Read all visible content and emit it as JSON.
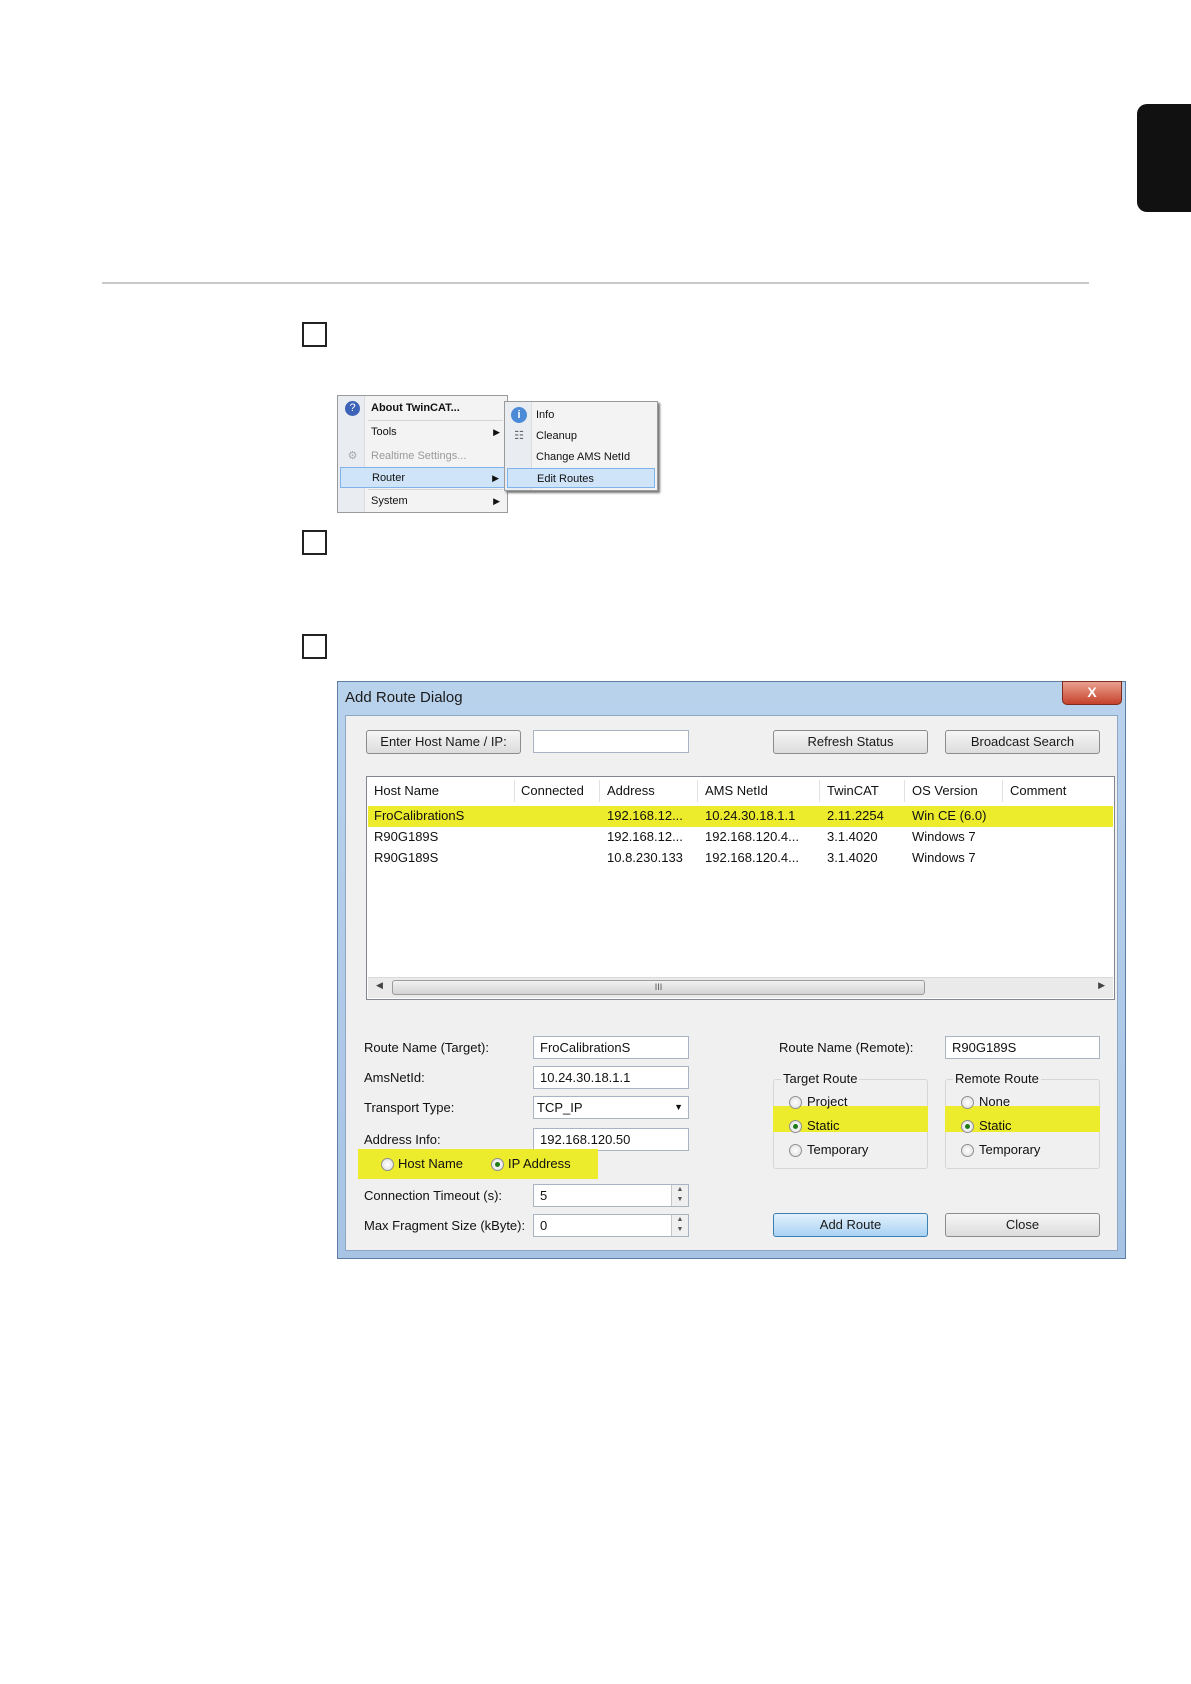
{
  "context_menu": {
    "items": [
      {
        "label": "About TwinCAT...",
        "icon": "question-icon"
      },
      {
        "label": "Tools",
        "icon": ""
      },
      {
        "label": "Realtime Settings...",
        "icon": "settings-icon"
      },
      {
        "label": "Router",
        "icon": ""
      },
      {
        "label": "System",
        "icon": ""
      }
    ],
    "submenu": [
      {
        "label": "Info",
        "icon": "info-icon"
      },
      {
        "label": "Cleanup",
        "icon": "cleanup-icon"
      },
      {
        "label": "Change AMS NetId",
        "icon": ""
      },
      {
        "label": "Edit Routes",
        "icon": ""
      }
    ]
  },
  "dialog": {
    "title": "Add Route Dialog",
    "close_glyph": "X",
    "buttons": {
      "enter_host": "Enter Host Name / IP:",
      "refresh": "Refresh Status",
      "broadcast": "Broadcast Search",
      "add_route": "Add Route",
      "close": "Close"
    },
    "host_input_value": "",
    "table": {
      "columns": [
        "Host Name",
        "Connected",
        "Address",
        "AMS NetId",
        "TwinCAT",
        "OS Version",
        "Comment"
      ],
      "rows": [
        [
          "FroCalibrationS",
          "",
          "192.168.12...",
          "10.24.30.18.1.1",
          "2.11.2254",
          "Win CE (6.0)",
          ""
        ],
        [
          "R90G189S",
          "",
          "192.168.12...",
          "192.168.120.4...",
          "3.1.4020",
          "Windows 7",
          ""
        ],
        [
          "R90G189S",
          "",
          "10.8.230.133",
          "192.168.120.4...",
          "3.1.4020",
          "Windows 7",
          ""
        ]
      ],
      "scroll_grip": "III"
    },
    "form": {
      "route_name_target_label": "Route Name (Target):",
      "route_name_target": "FroCalibrationS",
      "amsnetid_label": "AmsNetId:",
      "amsnetid": "10.24.30.18.1.1",
      "transport_label": "Transport Type:",
      "transport": "TCP_IP",
      "address_label": "Address Info:",
      "address": "192.168.120.50",
      "host_name_option": "Host Name",
      "ip_address_option": "IP Address",
      "timeout_label": "Connection Timeout (s):",
      "timeout": "5",
      "fragment_label": "Max Fragment Size (kByte):",
      "fragment": "0",
      "route_name_remote_label": "Route Name (Remote):",
      "route_name_remote": "R90G189S"
    },
    "target_route": {
      "title": "Target Route",
      "options": [
        "Project",
        "Static",
        "Temporary"
      ],
      "selected": "Static"
    },
    "remote_route": {
      "title": "Remote Route",
      "options": [
        "None",
        "Static",
        "Temporary"
      ],
      "selected": "Static"
    },
    "highlight_color": "#ecec2d"
  }
}
